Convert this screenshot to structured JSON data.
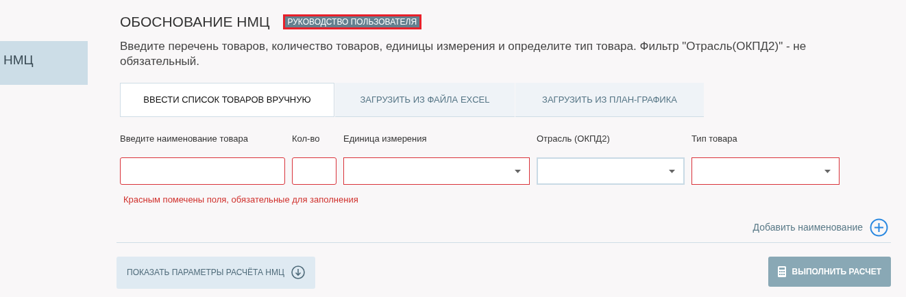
{
  "sidebar": {
    "items": [
      {
        "label": "НМЦ",
        "selected": true
      }
    ]
  },
  "header": {
    "title": "ОБОСНОВАНИЕ НМЦ",
    "guide_button": "РУКОВОДСТВО ПОЛЬЗОВАТЕЛЯ"
  },
  "description": "Введите перечень товаров, количество товаров, единицы измерения и определите тип товара. Фильтр \"Отрасль(ОКПД2)\" - не обязательный.",
  "tabs": [
    {
      "label": "ВВЕСТИ СПИСОК ТОВАРОВ ВРУЧНУЮ",
      "selected": true
    },
    {
      "label": "ЗАГРУЗИТЬ ИЗ ФАЙЛА EXCEL",
      "selected": false
    },
    {
      "label": "ЗАГРУЗИТЬ ИЗ ПЛАН-ГРАФИКА",
      "selected": false
    }
  ],
  "fields": [
    {
      "label": "Введите наименование товара",
      "kind": "text",
      "required": true
    },
    {
      "label": "Кол-во",
      "kind": "text",
      "required": true
    },
    {
      "label": "Единица измерения",
      "kind": "select",
      "required": true
    },
    {
      "label": "Отрасль (ОКПД2)",
      "kind": "select",
      "required": false
    },
    {
      "label": "Тип товара",
      "kind": "select",
      "required": true
    }
  ],
  "required_note": "Красным помечены поля, обязательные для заполнения",
  "add_link": "Добавить наименование",
  "show_params_button": "ПОКАЗАТЬ ПАРАМЕТРЫ РАСЧЁТА НМЦ",
  "calculate_button": {
    "label": "ВЫПОЛНИТЬ РАСЧЕТ",
    "disabled": true
  }
}
